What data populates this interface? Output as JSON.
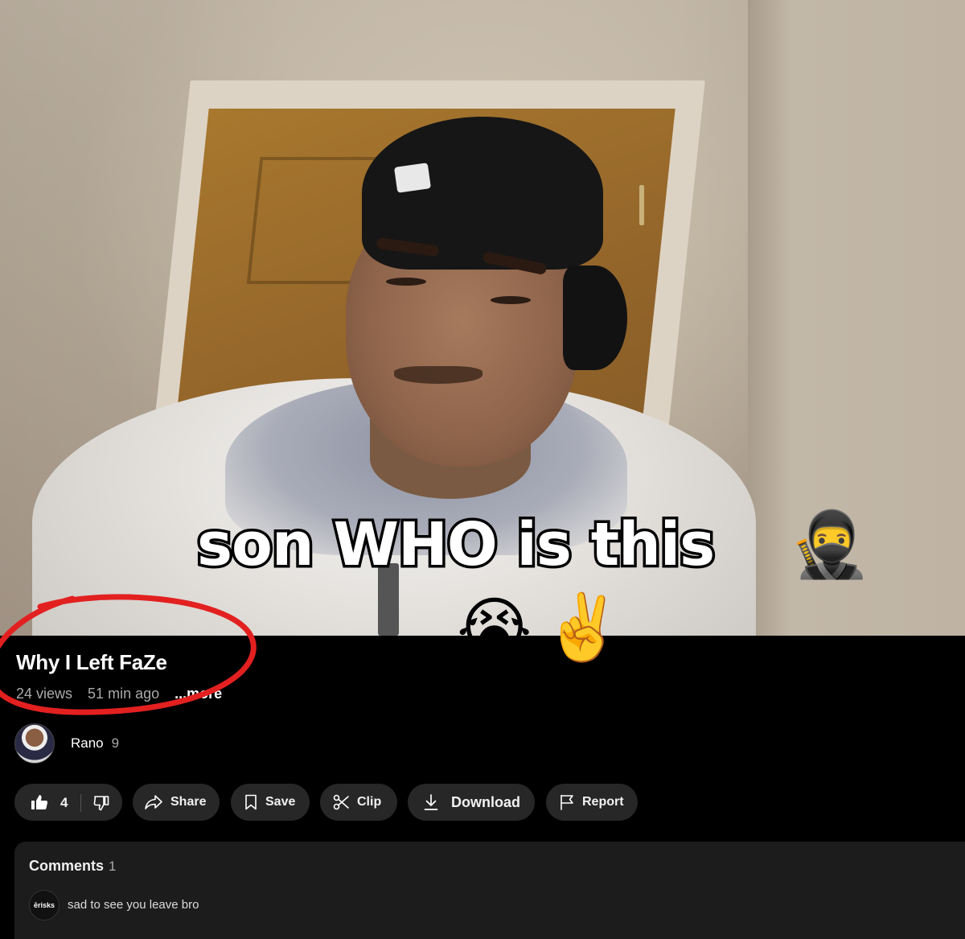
{
  "video": {
    "caption_text": "son WHO is this",
    "caption_emojis": [
      "🥷",
      "😭",
      "✌️"
    ]
  },
  "video_info": {
    "title": "Why I Left FaZe",
    "views": "24 views",
    "uploaded": "51 min ago",
    "more": "...more"
  },
  "channel": {
    "name": "Rano",
    "subscribers": "9"
  },
  "actions": {
    "like_count": "4",
    "share": "Share",
    "save": "Save",
    "clip": "Clip",
    "download": "Download",
    "report": "Report"
  },
  "comments": {
    "label": "Comments",
    "count": "1",
    "top_comment": {
      "author_badge": "ērisks",
      "text": "sad to see you leave bro"
    }
  },
  "colors": {
    "background": "#000000",
    "pill": "#272727",
    "comments_panel": "#1c1c1c",
    "annotation": "#e32020"
  }
}
